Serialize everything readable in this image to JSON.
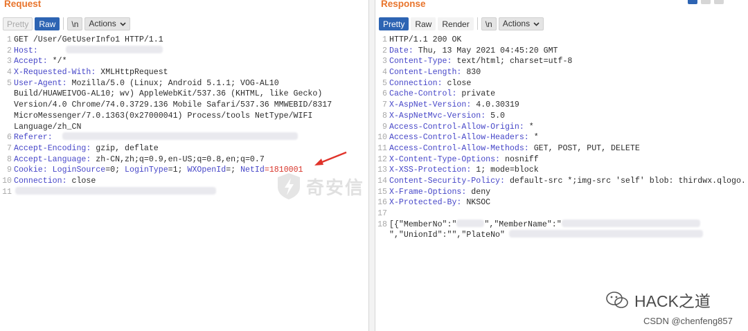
{
  "request": {
    "title": "Request",
    "buttons": {
      "pretty": "Pretty",
      "raw": "Raw",
      "newline": "\\n",
      "actions": "Actions"
    },
    "line_numbers": [
      "1",
      "2",
      "3",
      "4",
      "5",
      "",
      "",
      "",
      "",
      "6",
      "7",
      "8",
      "9",
      "10",
      "11"
    ],
    "lines": {
      "l1": "GET /User/GetUserInfo1 HTTP/1.1",
      "l2k": "Host:",
      "l3k": "Accept:",
      "l3v": " */*",
      "l4k": "X-Requested-With:",
      "l4v": " XMLHttpRequest",
      "l5k": "User-Agent:",
      "l5v": " Mozilla/5.0 (Linux; Android 5.1.1; VOG-AL10",
      "l5b": "Build/HUAWEIVOG-AL10; wv) AppleWebKit/537.36 (KHTML, like Gecko)",
      "l5c": "Version/4.0 Chrome/74.0.3729.136 Mobile Safari/537.36 MMWEBID/8317",
      "l5d": "MicroMessenger/7.0.1363(0x27000041) Process/tools NetType/WIFI",
      "l5e": "Language/zh_CN",
      "l6k": "Referer:",
      "l7k": "Accept-Encoding:",
      "l7v": " gzip, deflate",
      "l8k": "Accept-Language:",
      "l8v": " zh-CN,zh;q=0.9,en-US;q=0.8,en;q=0.7",
      "l9k": "Cookie:",
      "l9a": " LoginSource",
      "l9b": "=0; ",
      "l9c": "LoginType",
      "l9d": "=1; ",
      "l9e": "WXOpenId",
      "l9f": "=; ",
      "l9g": "NetId",
      "l9h": "=1810001",
      "l10k": "Connection:",
      "l10v": " close"
    }
  },
  "response": {
    "title": "Response",
    "buttons": {
      "pretty": "Pretty",
      "raw": "Raw",
      "render": "Render",
      "newline": "\\n",
      "actions": "Actions"
    },
    "line_numbers": [
      "1",
      "2",
      "3",
      "4",
      "5",
      "6",
      "7",
      "8",
      "9",
      "10",
      "11",
      "12",
      "13",
      "14",
      "15",
      "16",
      "17",
      "18",
      ""
    ],
    "lines": {
      "l1": "HTTP/1.1 200 OK",
      "l2k": "Date:",
      "l2v": " Thu, 13 May 2021 04:45:20 GMT",
      "l3k": "Content-Type:",
      "l3v": " text/html; charset=utf-8",
      "l4k": "Content-Length:",
      "l4v": " 830",
      "l5k": "Connection:",
      "l5v": " close",
      "l6k": "Cache-Control:",
      "l6v": " private",
      "l7k": "X-AspNet-Version:",
      "l7v": " 4.0.30319",
      "l8k": "X-AspNetMvc-Version:",
      "l8v": " 5.0",
      "l9k": "Access-Control-Allow-Origin:",
      "l9v": " *",
      "l10k": "Access-Control-Allow-Headers:",
      "l10v": " *",
      "l11k": "Access-Control-Allow-Methods:",
      "l11v": " GET, POST, PUT, DELETE",
      "l12k": "X-Content-Type-Options:",
      "l12v": " nosniff",
      "l13k": "X-XSS-Protection:",
      "l13v": " 1; mode=block",
      "l14k": "Content-Security-Policy:",
      "l14v": " default-src *;img-src 'self' blob: thirdwx.qlogo.",
      "l15k": "X-Frame-Options:",
      "l15v": " deny",
      "l16k": "X-Protected-By:",
      "l16v": " NKSOC",
      "l18a": "[{\"MemberNo\":\"",
      "l18b": "\",\"MemberName\":\"",
      "l18c": "\",\"UnionId\":\"\",\"PlateNo\""
    }
  },
  "watermark": {
    "hack": "HACK之道",
    "csdn": "CSDN @chenfeng857",
    "center": "奇安信"
  },
  "colors": {
    "header_title": "#e8742c",
    "active_button": "#2d64b3",
    "header_key": "#4646c8",
    "highlight": "#d8352b"
  }
}
